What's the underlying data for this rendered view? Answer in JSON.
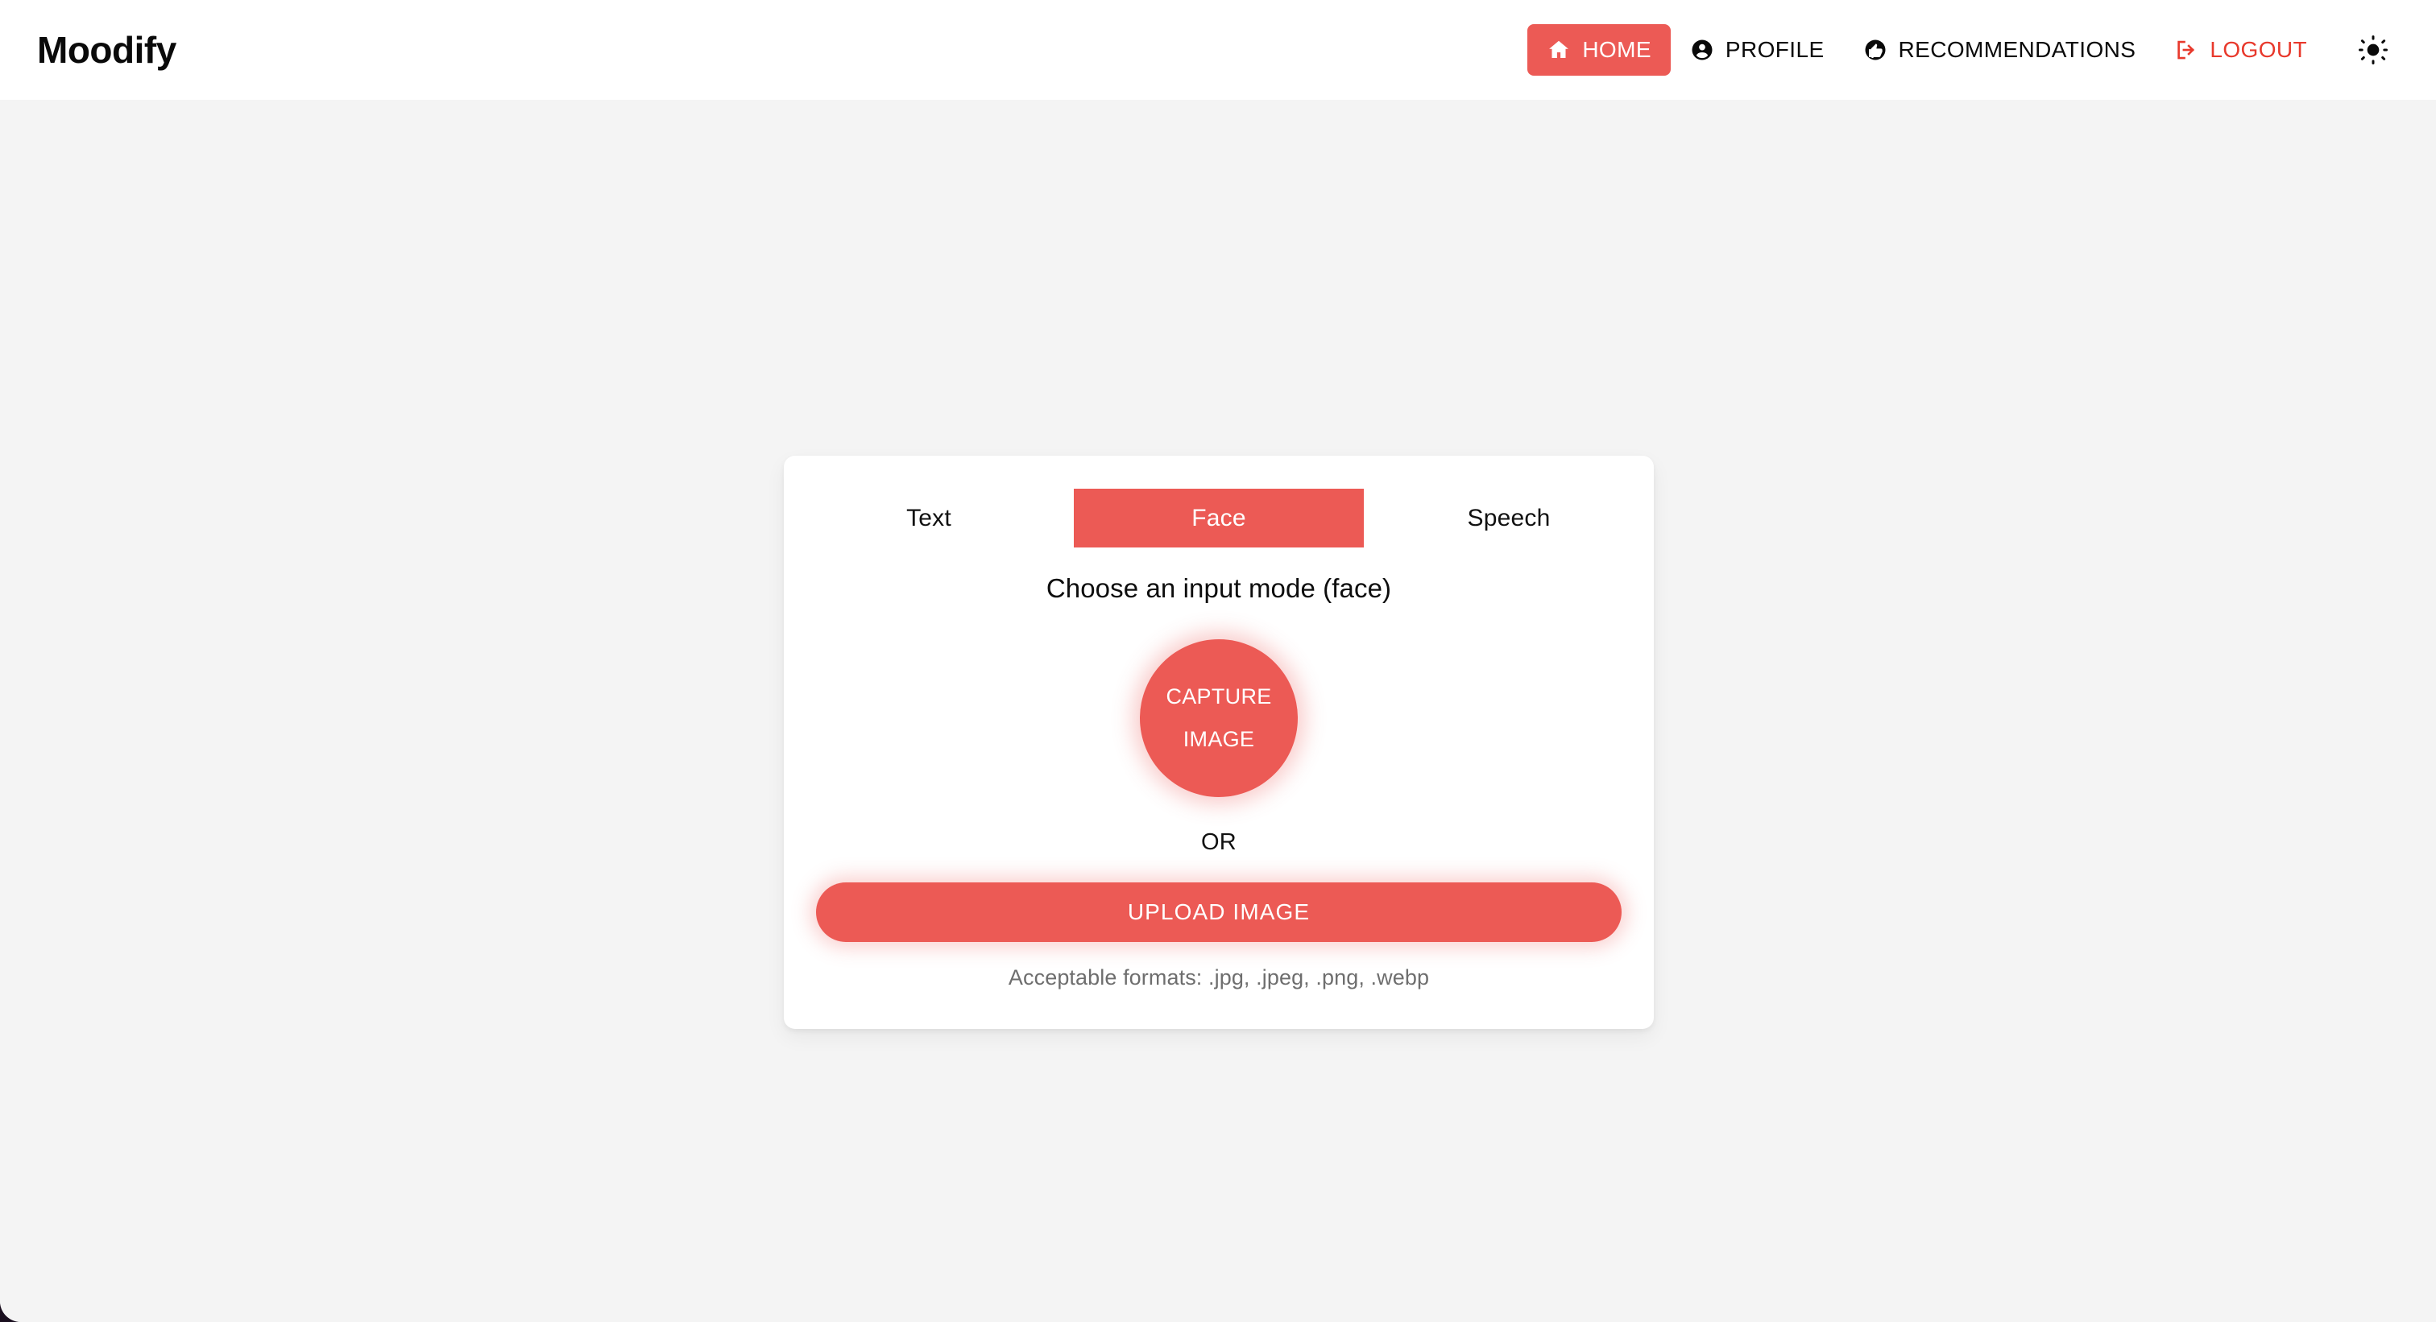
{
  "brand": {
    "name": "Moodify"
  },
  "navbar": {
    "items": [
      {
        "label": "HOME",
        "icon": "home-icon",
        "active": true
      },
      {
        "label": "PROFILE",
        "icon": "account-circle-icon",
        "active": false
      },
      {
        "label": "RECOMMENDATIONS",
        "icon": "thumb-up-circle-icon",
        "active": false
      },
      {
        "label": "LOGOUT",
        "icon": "logout-icon",
        "active": false
      }
    ],
    "theme_toggle": {
      "icon": "sun-icon",
      "label": "Toggle light mode"
    }
  },
  "card": {
    "tabs": [
      {
        "label": "Text",
        "active": false
      },
      {
        "label": "Face",
        "active": true
      },
      {
        "label": "Speech",
        "active": false
      }
    ],
    "heading": "Choose an input mode (face)",
    "capture_button": {
      "line1": "CAPTURE",
      "line2": "IMAGE"
    },
    "or_label": "OR",
    "upload_button": "UPLOAD IMAGE",
    "formats_note": "Acceptable formats: .jpg, .jpeg, .png, .webp"
  },
  "colors": {
    "accent": "#ec5a55",
    "logout": "#e8392c",
    "page_background": "#f4f4f4",
    "navbar_background": "#ffffff",
    "card_background": "#ffffff",
    "text_primary": "#0d0d0d",
    "text_muted": "#6e6e6e"
  }
}
